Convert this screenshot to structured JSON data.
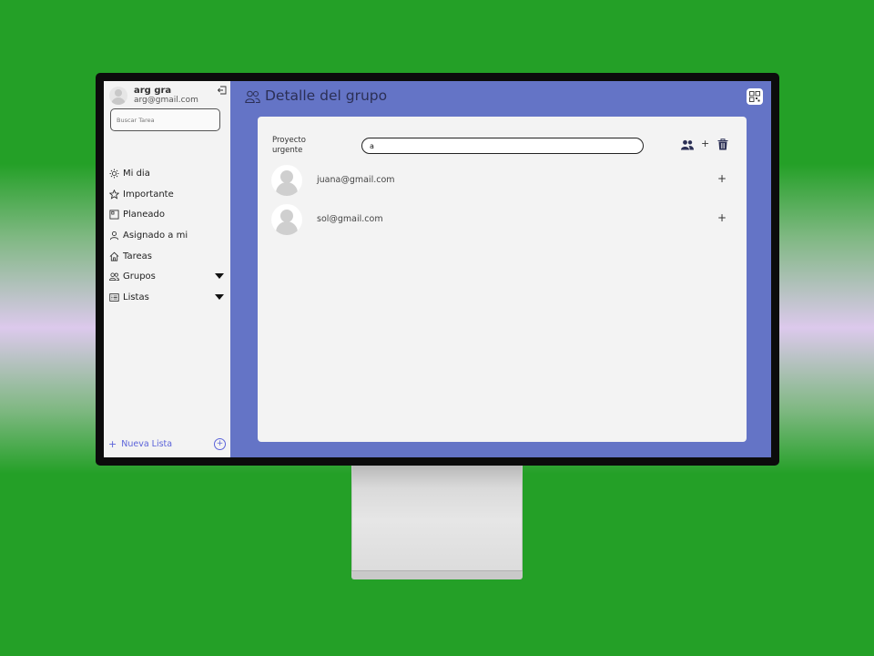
{
  "sidebar": {
    "user": {
      "name": "arg gra",
      "email": "arg@gmail.com"
    },
    "search": {
      "placeholder": "Buscar Tarea"
    },
    "items": [
      {
        "label": "Mi dia",
        "icon": "sun-icon"
      },
      {
        "label": "Importante",
        "icon": "star-icon"
      },
      {
        "label": "Planeado",
        "icon": "calendar-icon"
      },
      {
        "label": "Asignado a mi",
        "icon": "user-icon"
      },
      {
        "label": "Tareas",
        "icon": "home-icon"
      },
      {
        "label": "Grupos",
        "icon": "group-icon",
        "expandable": true
      },
      {
        "label": "Listas",
        "icon": "list-icon",
        "expandable": true
      }
    ],
    "new_list": {
      "label": "Nueva Lista",
      "plus": "+"
    }
  },
  "header": {
    "title": "Detalle del grupo",
    "icon": "group-icon"
  },
  "group": {
    "name": "Proyecto urgente",
    "input_value": "a",
    "add_symbol": "+",
    "members": [
      {
        "email": "juana@gmail.com",
        "add": "+"
      },
      {
        "email": "sol@gmail.com",
        "add": "+"
      }
    ]
  },
  "colors": {
    "accent": "#6474c6",
    "link": "#5b63d9",
    "panel": "#f3f3f3",
    "background": "#24a027"
  }
}
